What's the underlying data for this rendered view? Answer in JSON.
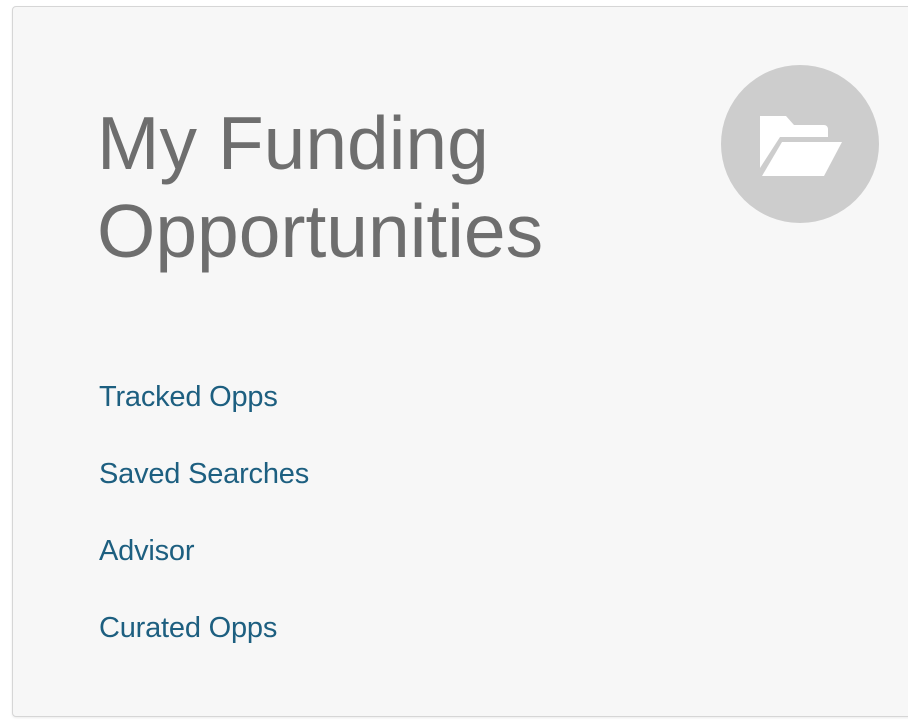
{
  "card": {
    "title_line1": "My Funding",
    "title_line2": "Opportunities",
    "icon": "folder-open-icon",
    "links": [
      {
        "label": "Tracked Opps"
      },
      {
        "label": "Saved Searches"
      },
      {
        "label": "Advisor"
      },
      {
        "label": "Curated Opps"
      }
    ]
  },
  "colors": {
    "title": "#6e6e6e",
    "link": "#1d5f80",
    "icon_circle": "#cdcdcd",
    "card_background": "#f7f7f7"
  }
}
